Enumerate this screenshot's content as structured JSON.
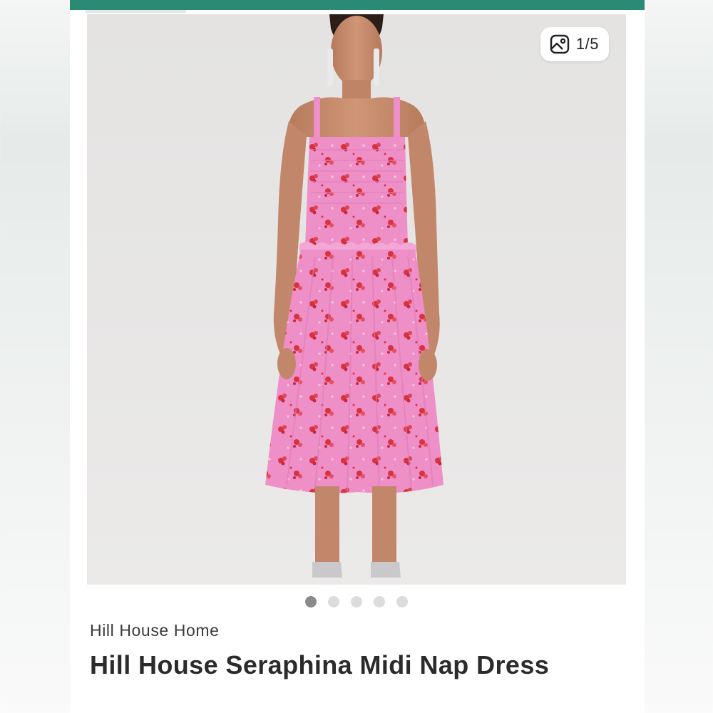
{
  "gallery": {
    "counter": "1/5",
    "counter_icon": "image-gallery-icon",
    "total_images": 5,
    "active_index": 1,
    "dots": [
      {
        "active": true
      },
      {
        "active": false
      },
      {
        "active": false
      },
      {
        "active": false
      },
      {
        "active": false
      }
    ]
  },
  "product": {
    "brand": "Hill House Home",
    "title": "Hill House Seraphina Midi Nap Dress"
  },
  "colors": {
    "accent": "#2a8a73",
    "dress_pink": "#ef8fc8",
    "dress_flower": "#d8323f",
    "skin": "#c68b6c",
    "background": "#e6e5e4"
  }
}
